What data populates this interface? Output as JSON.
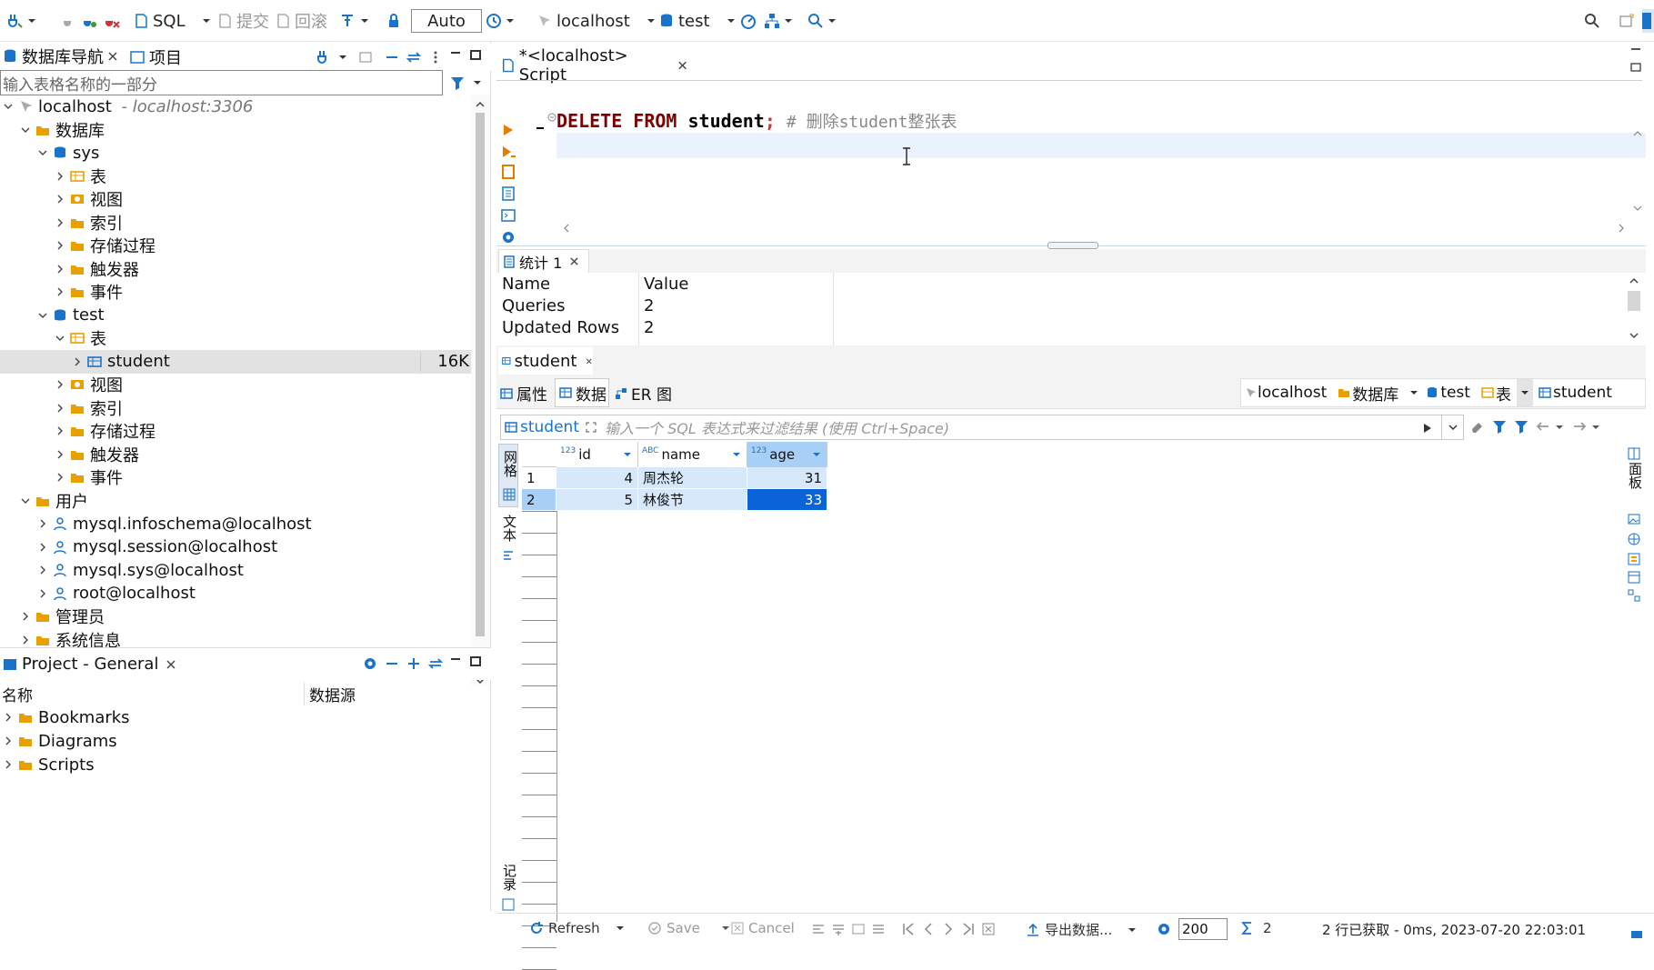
{
  "toolbar": {
    "sql_label": "SQL",
    "commit_label": "提交",
    "rollback_label": "回滚",
    "mode_value": "Auto",
    "datasource_label": "localhost",
    "schema_label": "test"
  },
  "nav_panel": {
    "tab_db_navigator": "数据库导航",
    "tab_project": "项目",
    "filter_placeholder": "输入表格名称的一部分",
    "tree": [
      {
        "label": "localhost",
        "sub": " - localhost:3306"
      },
      {
        "label": "数据库"
      },
      {
        "label": "sys"
      },
      {
        "label": "表"
      },
      {
        "label": "视图"
      },
      {
        "label": "索引"
      },
      {
        "label": "存储过程"
      },
      {
        "label": "触发器"
      },
      {
        "label": "事件"
      },
      {
        "label": "test"
      },
      {
        "label": "表"
      },
      {
        "label": "student",
        "size": "16K"
      },
      {
        "label": "视图"
      },
      {
        "label": "索引"
      },
      {
        "label": "存储过程"
      },
      {
        "label": "触发器"
      },
      {
        "label": "事件"
      },
      {
        "label": "用户"
      },
      {
        "label": "mysql.infoschema@localhost"
      },
      {
        "label": "mysql.session@localhost"
      },
      {
        "label": "mysql.sys@localhost"
      },
      {
        "label": "root@localhost"
      },
      {
        "label": "管理员"
      },
      {
        "label": "系统信息"
      }
    ]
  },
  "project_panel": {
    "title": "Project - General",
    "col_name": "名称",
    "col_datasource": "数据源",
    "items": [
      "Bookmarks",
      "Diagrams",
      "Scripts"
    ]
  },
  "editor": {
    "tab_title": "*<localhost> Script",
    "code_keyword1": "DELETE",
    "code_keyword2": "FROM",
    "code_table": "student",
    "code_semicolon": ";",
    "code_comment": "# 删除student整张表"
  },
  "stats": {
    "tab_title": "统计 1",
    "col_name": "Name",
    "col_value": "Value",
    "rows": [
      {
        "name": "Queries",
        "value": "2"
      },
      {
        "name": "Updated Rows",
        "value": "2"
      }
    ]
  },
  "results": {
    "tab_title": "student",
    "subtab_properties": "属性",
    "subtab_data": "数据",
    "subtab_er": "ER 图",
    "crumb_host": "localhost",
    "crumb_db": "数据库",
    "crumb_schema": "test",
    "crumb_tables": "表",
    "crumb_table": "student",
    "filter_table": "student",
    "filter_placeholder": "输入一个 SQL 表达式来过滤结果 (使用 Ctrl+Space)",
    "side_grid": "网格",
    "side_text": "文本",
    "side_record": "记录",
    "side_panels": "面板",
    "columns": [
      {
        "type": "123",
        "name": "id"
      },
      {
        "type": "ABC",
        "name": "name"
      },
      {
        "type": "123",
        "name": "age"
      }
    ],
    "rows": [
      {
        "num": "1",
        "id": "4",
        "name": "周杰轮",
        "age": "31"
      },
      {
        "num": "2",
        "id": "5",
        "name": "林俊节",
        "age": "33"
      }
    ]
  },
  "statusbar": {
    "refresh": "Refresh",
    "save": "Save",
    "cancel": "Cancel",
    "export": "导出数据...",
    "fetch_size": "200",
    "row_count": "2",
    "status_text": "2 行已获取 - 0ms, 2023-07-20 22:03:01"
  }
}
